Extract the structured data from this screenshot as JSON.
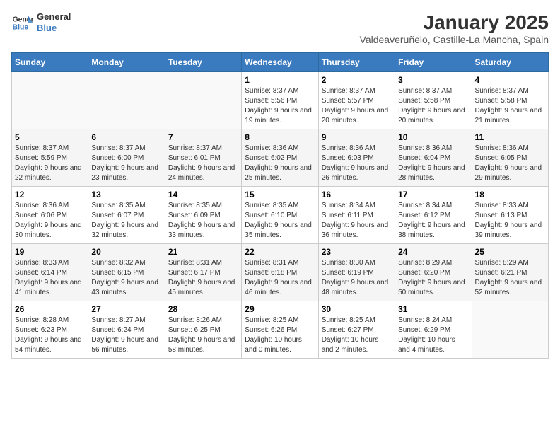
{
  "header": {
    "logo_line1": "General",
    "logo_line2": "Blue",
    "month": "January 2025",
    "location": "Valdeaveruñelo, Castille-La Mancha, Spain"
  },
  "days_of_week": [
    "Sunday",
    "Monday",
    "Tuesday",
    "Wednesday",
    "Thursday",
    "Friday",
    "Saturday"
  ],
  "weeks": [
    [
      {
        "day": "",
        "info": ""
      },
      {
        "day": "",
        "info": ""
      },
      {
        "day": "",
        "info": ""
      },
      {
        "day": "1",
        "info": "Sunrise: 8:37 AM\nSunset: 5:56 PM\nDaylight: 9 hours and 19 minutes."
      },
      {
        "day": "2",
        "info": "Sunrise: 8:37 AM\nSunset: 5:57 PM\nDaylight: 9 hours and 20 minutes."
      },
      {
        "day": "3",
        "info": "Sunrise: 8:37 AM\nSunset: 5:58 PM\nDaylight: 9 hours and 20 minutes."
      },
      {
        "day": "4",
        "info": "Sunrise: 8:37 AM\nSunset: 5:58 PM\nDaylight: 9 hours and 21 minutes."
      }
    ],
    [
      {
        "day": "5",
        "info": "Sunrise: 8:37 AM\nSunset: 5:59 PM\nDaylight: 9 hours and 22 minutes."
      },
      {
        "day": "6",
        "info": "Sunrise: 8:37 AM\nSunset: 6:00 PM\nDaylight: 9 hours and 23 minutes."
      },
      {
        "day": "7",
        "info": "Sunrise: 8:37 AM\nSunset: 6:01 PM\nDaylight: 9 hours and 24 minutes."
      },
      {
        "day": "8",
        "info": "Sunrise: 8:36 AM\nSunset: 6:02 PM\nDaylight: 9 hours and 25 minutes."
      },
      {
        "day": "9",
        "info": "Sunrise: 8:36 AM\nSunset: 6:03 PM\nDaylight: 9 hours and 26 minutes."
      },
      {
        "day": "10",
        "info": "Sunrise: 8:36 AM\nSunset: 6:04 PM\nDaylight: 9 hours and 28 minutes."
      },
      {
        "day": "11",
        "info": "Sunrise: 8:36 AM\nSunset: 6:05 PM\nDaylight: 9 hours and 29 minutes."
      }
    ],
    [
      {
        "day": "12",
        "info": "Sunrise: 8:36 AM\nSunset: 6:06 PM\nDaylight: 9 hours and 30 minutes."
      },
      {
        "day": "13",
        "info": "Sunrise: 8:35 AM\nSunset: 6:07 PM\nDaylight: 9 hours and 32 minutes."
      },
      {
        "day": "14",
        "info": "Sunrise: 8:35 AM\nSunset: 6:09 PM\nDaylight: 9 hours and 33 minutes."
      },
      {
        "day": "15",
        "info": "Sunrise: 8:35 AM\nSunset: 6:10 PM\nDaylight: 9 hours and 35 minutes."
      },
      {
        "day": "16",
        "info": "Sunrise: 8:34 AM\nSunset: 6:11 PM\nDaylight: 9 hours and 36 minutes."
      },
      {
        "day": "17",
        "info": "Sunrise: 8:34 AM\nSunset: 6:12 PM\nDaylight: 9 hours and 38 minutes."
      },
      {
        "day": "18",
        "info": "Sunrise: 8:33 AM\nSunset: 6:13 PM\nDaylight: 9 hours and 39 minutes."
      }
    ],
    [
      {
        "day": "19",
        "info": "Sunrise: 8:33 AM\nSunset: 6:14 PM\nDaylight: 9 hours and 41 minutes."
      },
      {
        "day": "20",
        "info": "Sunrise: 8:32 AM\nSunset: 6:15 PM\nDaylight: 9 hours and 43 minutes."
      },
      {
        "day": "21",
        "info": "Sunrise: 8:31 AM\nSunset: 6:17 PM\nDaylight: 9 hours and 45 minutes."
      },
      {
        "day": "22",
        "info": "Sunrise: 8:31 AM\nSunset: 6:18 PM\nDaylight: 9 hours and 46 minutes."
      },
      {
        "day": "23",
        "info": "Sunrise: 8:30 AM\nSunset: 6:19 PM\nDaylight: 9 hours and 48 minutes."
      },
      {
        "day": "24",
        "info": "Sunrise: 8:29 AM\nSunset: 6:20 PM\nDaylight: 9 hours and 50 minutes."
      },
      {
        "day": "25",
        "info": "Sunrise: 8:29 AM\nSunset: 6:21 PM\nDaylight: 9 hours and 52 minutes."
      }
    ],
    [
      {
        "day": "26",
        "info": "Sunrise: 8:28 AM\nSunset: 6:23 PM\nDaylight: 9 hours and 54 minutes."
      },
      {
        "day": "27",
        "info": "Sunrise: 8:27 AM\nSunset: 6:24 PM\nDaylight: 9 hours and 56 minutes."
      },
      {
        "day": "28",
        "info": "Sunrise: 8:26 AM\nSunset: 6:25 PM\nDaylight: 9 hours and 58 minutes."
      },
      {
        "day": "29",
        "info": "Sunrise: 8:25 AM\nSunset: 6:26 PM\nDaylight: 10 hours and 0 minutes."
      },
      {
        "day": "30",
        "info": "Sunrise: 8:25 AM\nSunset: 6:27 PM\nDaylight: 10 hours and 2 minutes."
      },
      {
        "day": "31",
        "info": "Sunrise: 8:24 AM\nSunset: 6:29 PM\nDaylight: 10 hours and 4 minutes."
      },
      {
        "day": "",
        "info": ""
      }
    ]
  ]
}
